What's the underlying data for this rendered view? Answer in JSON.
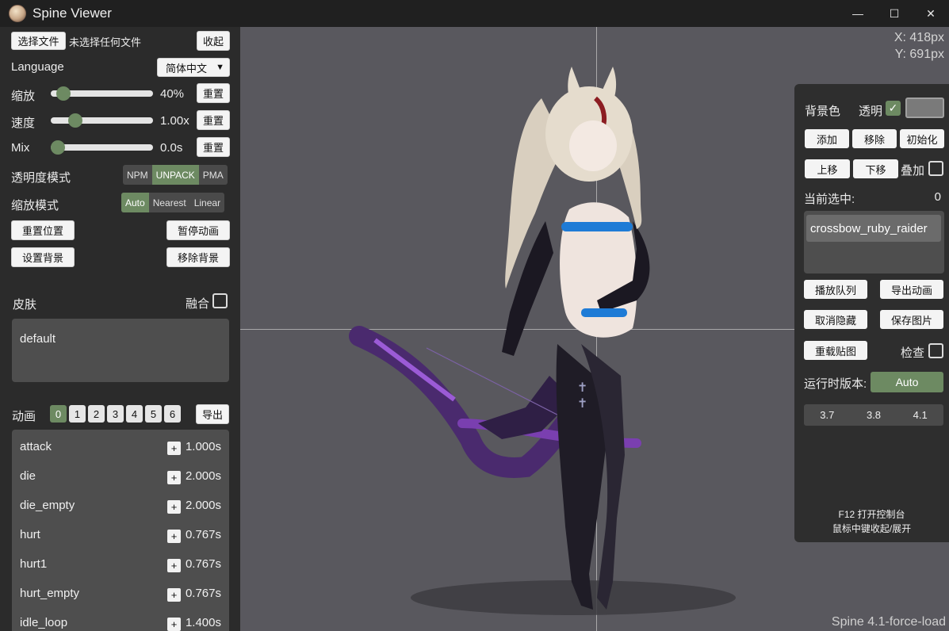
{
  "window": {
    "title": "Spine Viewer",
    "minimize": "—",
    "maximize": "☐",
    "close": "✕"
  },
  "left": {
    "choose_file_button": "选择文件",
    "no_file_text": "未选择任何文件",
    "collapse_button": "收起",
    "language_label": "Language",
    "language_value": "简体中文",
    "scale_label": "缩放",
    "scale_value": "40%",
    "scale_fraction": 0.06,
    "speed_label": "速度",
    "speed_value": "1.00x",
    "speed_fraction": 0.2,
    "mix_label": "Mix",
    "mix_value": "0.0s",
    "mix_fraction": 0.0,
    "reset_button": "重置",
    "alpha_mode_label": "透明度模式",
    "alpha_modes": [
      "NPM",
      "UNPACK",
      "PMA"
    ],
    "alpha_mode_active": "UNPACK",
    "scale_mode_label": "缩放模式",
    "scale_modes": [
      "Auto",
      "Nearest",
      "Linear"
    ],
    "scale_mode_active": "Auto",
    "reset_position_button": "重置位置",
    "pause_animation_button": "暂停动画",
    "set_background_button": "设置背景",
    "remove_background_button": "移除背景",
    "skin_label": "皮肤",
    "blend_label": "融合",
    "skins": [
      "default"
    ],
    "animation_label": "动画",
    "animation_tracks": [
      "0",
      "1",
      "2",
      "3",
      "4",
      "5",
      "6"
    ],
    "animation_track_active": "0",
    "export_button": "导出",
    "add_symbol": "+",
    "animations": [
      {
        "name": "attack",
        "duration": "1.000s"
      },
      {
        "name": "die",
        "duration": "2.000s"
      },
      {
        "name": "die_empty",
        "duration": "2.000s"
      },
      {
        "name": "hurt",
        "duration": "0.767s"
      },
      {
        "name": "hurt1",
        "duration": "0.767s"
      },
      {
        "name": "hurt_empty",
        "duration": "0.767s"
      },
      {
        "name": "idle_loop",
        "duration": "1.400s"
      }
    ]
  },
  "viewport": {
    "x_readout": "X: 418px",
    "y_readout": "Y: 691px",
    "runtime_label": "Spine 4.1-force-load"
  },
  "right": {
    "bg_color_label": "背景色",
    "transparent_label": "透明",
    "add_button": "添加",
    "remove_button": "移除",
    "init_button": "初始化",
    "move_up_button": "上移",
    "move_down_button": "下移",
    "overlay_label": "叠加",
    "current_selected_label": "当前选中:",
    "current_selected_value": "0",
    "layers": [
      "crossbow_ruby_raider"
    ],
    "play_queue_button": "播放队列",
    "export_animation_button": "导出动画",
    "unhide_button": "取消隐藏",
    "save_image_button": "保存图片",
    "reload_texture_button": "重载贴图",
    "inspect_label": "检查",
    "runtime_version_label": "运行时版本:",
    "runtime_auto_button": "Auto",
    "runtime_versions": [
      "3.7",
      "3.8",
      "4.1"
    ],
    "hint_console": "F12 打开控制台",
    "hint_middle_click": "鼠标中键收起/展开"
  },
  "colors": {
    "accent": "#6d8a62",
    "viewport_bg": "#59585e",
    "panel_bg": "#2b2b2b"
  }
}
